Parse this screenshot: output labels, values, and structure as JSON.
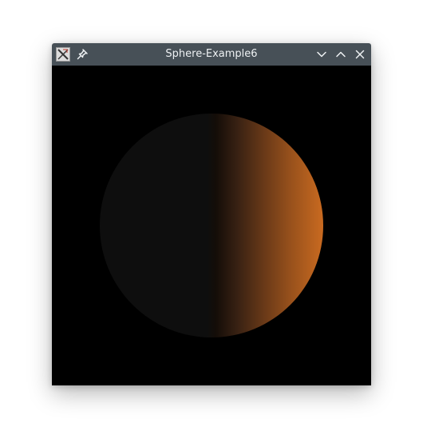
{
  "window": {
    "title": "Sphere-Example6"
  },
  "icons": {
    "app": "xterm-app-icon",
    "pin": "pin-icon",
    "minimize": "chevron-down-icon",
    "maximize": "chevron-up-icon",
    "close": "close-icon"
  },
  "colors": {
    "titlebar": "#475057",
    "background": "#000000",
    "sphere_dark": "#0e0e0e",
    "sphere_lit": "#c96a20"
  }
}
